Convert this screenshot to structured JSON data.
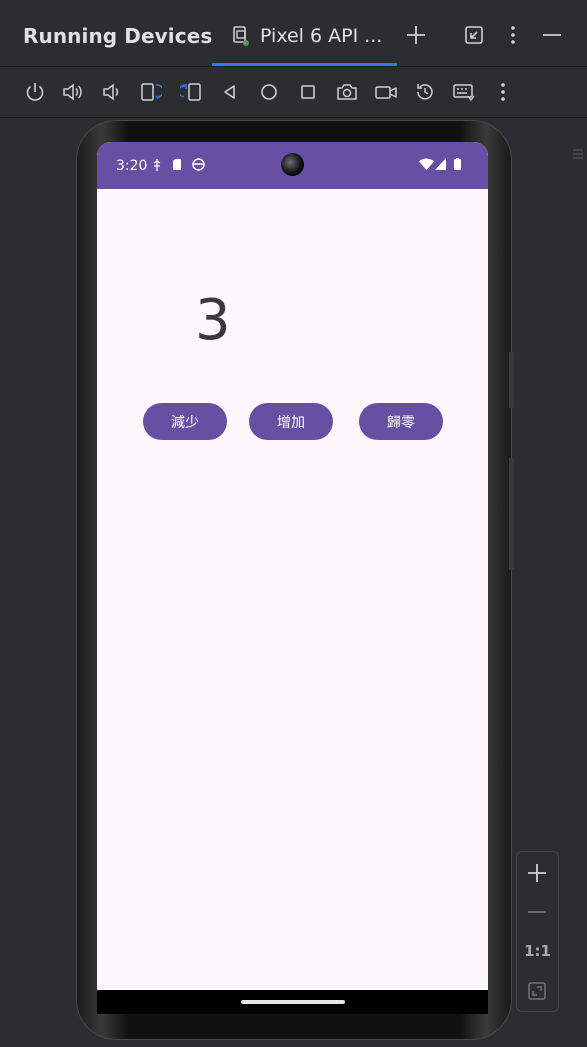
{
  "window": {
    "title": "Running Devices",
    "tab_label": "Pixel 6 API ..."
  },
  "toolbar": {
    "items": [
      "power",
      "volume-up",
      "volume-down",
      "rotate-left",
      "rotate-right",
      "back",
      "home",
      "overview",
      "screenshot",
      "screen-record",
      "reset",
      "keyboard",
      "more"
    ]
  },
  "device": {
    "status_time": "3:20",
    "counter_value": "3",
    "buttons": {
      "decrease": "減少",
      "increase": "增加",
      "reset": "歸零"
    }
  },
  "zoom": {
    "ratio_label": "1:1"
  },
  "colors": {
    "accent": "#3574f0",
    "app_primary": "#6750a4",
    "app_background": "#fef7fc",
    "ide_background": "#2b2d30"
  }
}
